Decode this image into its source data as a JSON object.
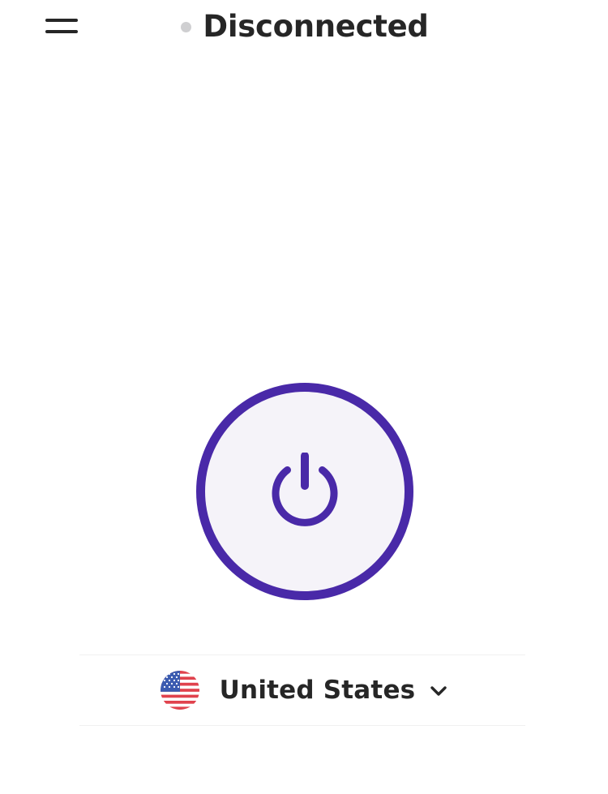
{
  "header": {
    "menu_icon": "hamburger-menu-icon",
    "status": {
      "text": "Disconnected",
      "dot_color": "#cfcfd1"
    }
  },
  "power": {
    "icon": "power-icon",
    "accent_color": "#4929a8",
    "fill_color": "#f5f3f9"
  },
  "location": {
    "country": "United States",
    "flag_icon": "us-flag-icon",
    "dropdown_icon": "chevron-down-icon"
  }
}
